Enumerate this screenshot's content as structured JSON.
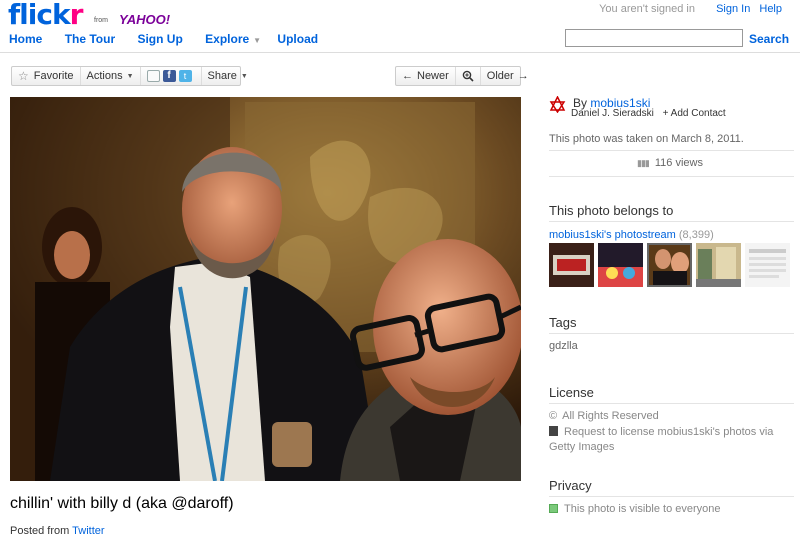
{
  "logo": {
    "brand_blue": "flick",
    "brand_pink": "r",
    "from": "from",
    "yahoo": "YAHOO!"
  },
  "header": {
    "not_signed_in": "You aren't signed in",
    "sign_in": "Sign In",
    "help": "Help",
    "nav": {
      "home": "Home",
      "tour": "The Tour",
      "signup": "Sign Up",
      "explore": "Explore",
      "upload": "Upload"
    },
    "search_value": "",
    "search_button": "Search"
  },
  "toolbar": {
    "favorite": "Favorite",
    "actions": "Actions",
    "share": "Share",
    "newer": "Newer",
    "older": "Older",
    "newer_arrow": "←",
    "older_arrow": "→"
  },
  "photo": {
    "title": "chillin' with billy d (aka @daroff)",
    "posted_from_label": "Posted from",
    "posted_from_source": "Twitter"
  },
  "owner": {
    "by_label": "By",
    "username": "mobius1ski",
    "real_name": "Daniel J. Sieradski",
    "add_contact": "+ Add Contact"
  },
  "taken_text": "This photo was taken on March 8, 2011.",
  "views_text": "116 views",
  "belongs": {
    "title": "This photo belongs to",
    "photostream": "mobius1ski's photostream",
    "count": "(8,399)"
  },
  "tags": {
    "title": "Tags",
    "items": [
      "gdzlla"
    ]
  },
  "license": {
    "title": "License",
    "rights": "All Rights Reserved",
    "request": "Request to license mobius1ski's photos via Getty Images"
  },
  "privacy": {
    "title": "Privacy",
    "text": "This photo is visible to everyone"
  },
  "colors": {
    "link": "#0063dc",
    "pink": "#ff0084",
    "yahoo": "#7b0099"
  }
}
